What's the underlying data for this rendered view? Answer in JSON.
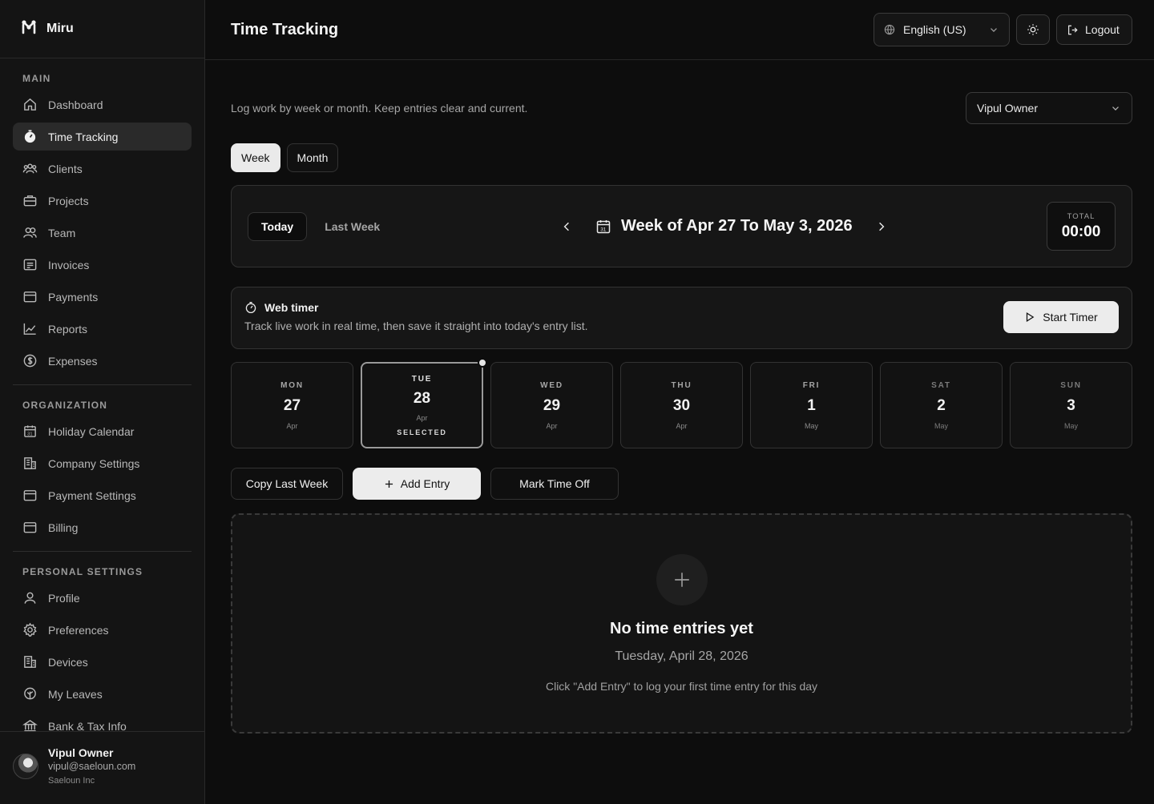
{
  "brand": {
    "name": "Miru"
  },
  "sidebar": {
    "sections": [
      {
        "label": "MAIN",
        "items": [
          {
            "label": "Dashboard",
            "icon": "home-icon"
          },
          {
            "label": "Time Tracking",
            "icon": "stopwatch-icon",
            "active": true
          },
          {
            "label": "Clients",
            "icon": "users-icon"
          },
          {
            "label": "Projects",
            "icon": "briefcase-icon"
          },
          {
            "label": "Team",
            "icon": "team-icon"
          },
          {
            "label": "Invoices",
            "icon": "invoice-icon"
          },
          {
            "label": "Payments",
            "icon": "wallet-icon"
          },
          {
            "label": "Reports",
            "icon": "chart-icon"
          },
          {
            "label": "Expenses",
            "icon": "dollar-icon"
          }
        ]
      },
      {
        "label": "ORGANIZATION",
        "items": [
          {
            "label": "Holiday Calendar",
            "icon": "calendar-icon"
          },
          {
            "label": "Company Settings",
            "icon": "building-icon"
          },
          {
            "label": "Payment Settings",
            "icon": "wallet-icon"
          },
          {
            "label": "Billing",
            "icon": "wallet-icon"
          }
        ]
      },
      {
        "label": "PERSONAL SETTINGS",
        "items": [
          {
            "label": "Profile",
            "icon": "user-icon"
          },
          {
            "label": "Preferences",
            "icon": "gear-icon"
          },
          {
            "label": "Devices",
            "icon": "building-icon"
          },
          {
            "label": "My Leaves",
            "icon": "leaf-icon"
          },
          {
            "label": "Bank & Tax Info",
            "icon": "bank-icon"
          }
        ]
      }
    ],
    "user": {
      "name": "Vipul Owner",
      "email": "vipul@saeloun.com",
      "org": "Saeloun Inc"
    }
  },
  "header": {
    "title": "Time Tracking",
    "language": "English (US)",
    "logout_label": "Logout"
  },
  "main": {
    "subtitle": "Log work by week or month. Keep entries clear and current.",
    "selected_user": "Vipul Owner",
    "view_tabs": [
      {
        "label": "Week",
        "active": true
      },
      {
        "label": "Month",
        "active": false
      }
    ],
    "week_nav": {
      "today_label": "Today",
      "last_week_label": "Last Week",
      "week_label": "Week of Apr 27 To May 3, 2026",
      "total_label": "TOTAL",
      "total_value": "00:00"
    },
    "timer": {
      "title": "Web timer",
      "description": "Track live work in real time, then save it straight into today's entry list.",
      "start_label": "Start Timer"
    },
    "days": [
      {
        "name": "MON",
        "num": "27",
        "month": "Apr"
      },
      {
        "name": "TUE",
        "num": "28",
        "month": "Apr",
        "selected": true,
        "selected_label": "SELECTED"
      },
      {
        "name": "WED",
        "num": "29",
        "month": "Apr"
      },
      {
        "name": "THU",
        "num": "30",
        "month": "Apr"
      },
      {
        "name": "FRI",
        "num": "1",
        "month": "May"
      },
      {
        "name": "SAT",
        "num": "2",
        "month": "May",
        "weekend": true
      },
      {
        "name": "SUN",
        "num": "3",
        "month": "May",
        "weekend": true
      }
    ],
    "actions": {
      "copy_label": "Copy Last Week",
      "add_label": "Add Entry",
      "timeoff_label": "Mark Time Off"
    },
    "empty": {
      "title": "No time entries yet",
      "date": "Tuesday, April 28, 2026",
      "hint": "Click \"Add Entry\" to log your first time entry for this day"
    }
  }
}
